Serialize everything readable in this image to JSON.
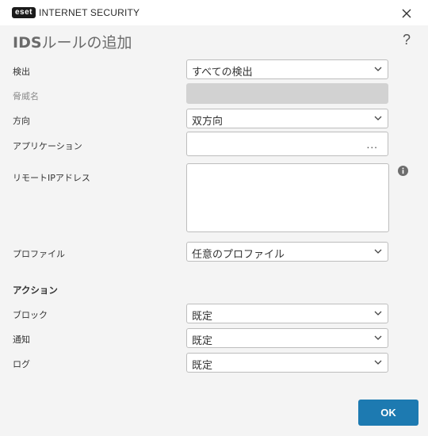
{
  "app": {
    "logo_badge": "eset",
    "title": "INTERNET SECURITY"
  },
  "dialog": {
    "title_prefix": "IDS",
    "title_suffix": "ルールの追加",
    "help": "?"
  },
  "form": {
    "detection": {
      "label": "検出",
      "value": "すべての検出"
    },
    "threat_name": {
      "label": "脅威名",
      "value": ""
    },
    "direction": {
      "label": "方向",
      "value": "双方向"
    },
    "application": {
      "label": "アプリケーション",
      "value": "",
      "browse": "..."
    },
    "remote_ip": {
      "label": "リモートIPアドレス",
      "value": ""
    },
    "profile": {
      "label": "プロファイル",
      "value": "任意のプロファイル"
    }
  },
  "actions": {
    "heading": "アクション",
    "block": {
      "label": "ブロック",
      "value": "既定"
    },
    "notify": {
      "label": "通知",
      "value": "既定"
    },
    "log": {
      "label": "ログ",
      "value": "既定"
    }
  },
  "footer": {
    "ok": "OK"
  },
  "colors": {
    "accent": "#1d7ab1",
    "background": "#f4f4f4",
    "disabled_field": "#d2d2d2"
  },
  "icons": {
    "close": "close-icon",
    "select": "chevron-down-icon",
    "info": "info-icon"
  }
}
